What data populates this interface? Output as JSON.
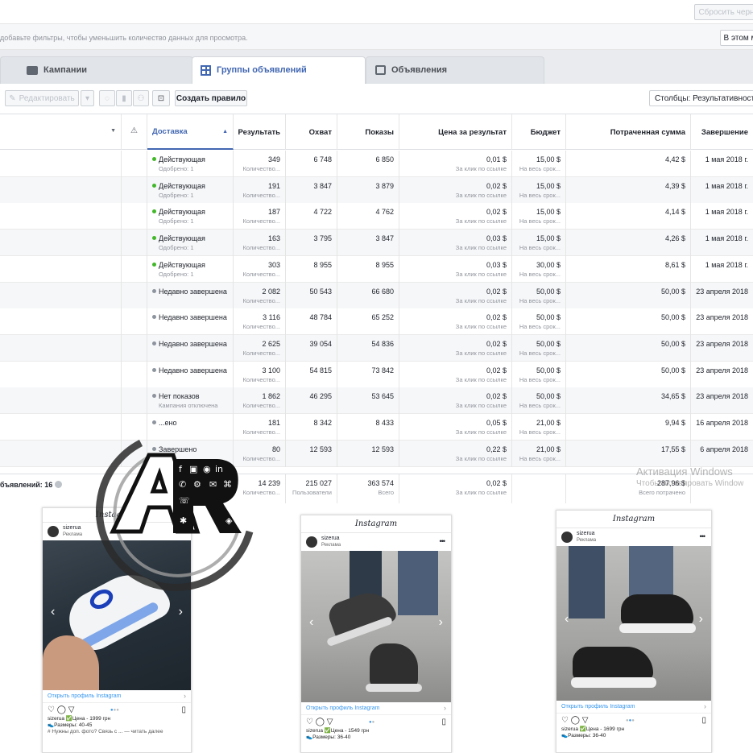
{
  "topbar": {
    "reset_label": "Сбросить черн",
    "filter_hint": "добавьте фильтры, чтобы уменьшить количество данных для просмотра.",
    "period_label": "В этом м"
  },
  "tabs": [
    {
      "label": "Кампании",
      "icon": "briefcase-icon"
    },
    {
      "label": "Группы объявлений",
      "icon": "grid-icon"
    },
    {
      "label": "Объявления",
      "icon": "monitor-icon"
    }
  ],
  "toolbar": {
    "edit_label": "Редактировать",
    "create_rule_label": "Создать правило",
    "columns_label": "Столбцы: Результативность"
  },
  "columns": [
    "Доставка",
    "Результать",
    "Охват",
    "Показы",
    "Цена за результат",
    "Бюджет",
    "Потраченная сумма",
    "Завершение"
  ],
  "rows": [
    {
      "status": "Действующая",
      "sub": "Одобрено: 1",
      "state": "active",
      "result": "349",
      "result_sub": "Количество...",
      "reach": "6 748",
      "impr": "6 850",
      "cpr": "0,01 $",
      "cpr_sub": "За клик по ссылке",
      "budget": "15,00 $",
      "budget_sub": "На весь срок...",
      "spent": "4,42 $",
      "end": "1 мая 2018 г."
    },
    {
      "status": "Действующая",
      "sub": "Одобрено: 1",
      "state": "active",
      "result": "191",
      "result_sub": "Количество...",
      "reach": "3 847",
      "impr": "3 879",
      "cpr": "0,02 $",
      "cpr_sub": "За клик по ссылке",
      "budget": "15,00 $",
      "budget_sub": "На весь срок...",
      "spent": "4,39 $",
      "end": "1 мая 2018 г."
    },
    {
      "status": "Действующая",
      "sub": "Одобрено: 1",
      "state": "active",
      "result": "187",
      "result_sub": "Количество...",
      "reach": "4 722",
      "impr": "4 762",
      "cpr": "0,02 $",
      "cpr_sub": "За клик по ссылке",
      "budget": "15,00 $",
      "budget_sub": "На весь срок...",
      "spent": "4,14 $",
      "end": "1 мая 2018 г."
    },
    {
      "status": "Действующая",
      "sub": "Одобрено: 1",
      "state": "active",
      "result": "163",
      "result_sub": "Количество...",
      "reach": "3 795",
      "impr": "3 847",
      "cpr": "0,03 $",
      "cpr_sub": "За клик по ссылке",
      "budget": "15,00 $",
      "budget_sub": "На весь срок...",
      "spent": "4,26 $",
      "end": "1 мая 2018 г."
    },
    {
      "status": "Действующая",
      "sub": "Одобрено: 1",
      "state": "active",
      "result": "303",
      "result_sub": "Количество...",
      "reach": "8 955",
      "impr": "8 955",
      "cpr": "0,03 $",
      "cpr_sub": "За клик по ссылке",
      "budget": "30,00 $",
      "budget_sub": "На весь срок...",
      "spent": "8,61 $",
      "end": "1 мая 2018 г."
    },
    {
      "status": "Недавно завершена",
      "sub": "",
      "state": "ended",
      "result": "2 082",
      "result_sub": "Количество...",
      "reach": "50 543",
      "impr": "66 680",
      "cpr": "0,02 $",
      "cpr_sub": "За клик по ссылке",
      "budget": "50,00 $",
      "budget_sub": "На весь срок...",
      "spent": "50,00 $",
      "end": "23 апреля 2018"
    },
    {
      "status": "Недавно завершена",
      "sub": "",
      "state": "ended",
      "result": "3 116",
      "result_sub": "Количество...",
      "reach": "48 784",
      "impr": "65 252",
      "cpr": "0,02 $",
      "cpr_sub": "За клик по ссылке",
      "budget": "50,00 $",
      "budget_sub": "На весь срок...",
      "spent": "50,00 $",
      "end": "23 апреля 2018"
    },
    {
      "status": "Недавно завершена",
      "sub": "",
      "state": "ended",
      "result": "2 625",
      "result_sub": "Количество...",
      "reach": "39 054",
      "impr": "54 836",
      "cpr": "0,02 $",
      "cpr_sub": "За клик по ссылке",
      "budget": "50,00 $",
      "budget_sub": "На весь срок...",
      "spent": "50,00 $",
      "end": "23 апреля 2018"
    },
    {
      "status": "Недавно завершена",
      "sub": "",
      "state": "ended",
      "result": "3 100",
      "result_sub": "Количество...",
      "reach": "54 815",
      "impr": "73 842",
      "cpr": "0,02 $",
      "cpr_sub": "За клик по ссылке",
      "budget": "50,00 $",
      "budget_sub": "На весь срок...",
      "spent": "50,00 $",
      "end": "23 апреля 2018"
    },
    {
      "status": "Нет показов",
      "sub": "Кампания отключена",
      "state": "ended",
      "result": "1 862",
      "result_sub": "Количество...",
      "reach": "46 295",
      "impr": "53 645",
      "cpr": "0,02 $",
      "cpr_sub": "За клик по ссылке",
      "budget": "50,00 $",
      "budget_sub": "На весь срок...",
      "spent": "34,65 $",
      "end": "23 апреля 2018"
    },
    {
      "status": "...ено",
      "sub": "",
      "state": "ended",
      "result": "181",
      "result_sub": "Количество...",
      "reach": "8 342",
      "impr": "8 433",
      "cpr": "0,05 $",
      "cpr_sub": "За клик по ссылке",
      "budget": "21,00 $",
      "budget_sub": "На весь срок...",
      "spent": "9,94 $",
      "end": "16 апреля 2018"
    },
    {
      "status": "Завершено",
      "sub": "",
      "state": "ended",
      "result": "80",
      "result_sub": "Количество...",
      "reach": "12 593",
      "impr": "12 593",
      "cpr": "0,22 $",
      "cpr_sub": "За клик по ссылке",
      "budget": "21,00 $",
      "budget_sub": "На весь срок...",
      "spent": "17,55 $",
      "end": "6 апреля 2018"
    }
  ],
  "totals": {
    "label": "бъявлений: 16",
    "result": "14 239",
    "result_sub": "Количество...",
    "reach": "215 027",
    "reach_sub": "Пользователи",
    "impr": "363 574",
    "impr_sub": "Всего",
    "cpr": "0,02 $",
    "cpr_sub": "За клик по ссылке",
    "spent": "287,96 $",
    "spent_sub": "Всего потрачено"
  },
  "watermark": {
    "line1": "Активация Windows",
    "line2": "Чтобы активировать Window"
  },
  "logo_text": "AR",
  "instagram_cards": [
    {
      "brand": "Instagram",
      "account": "sizerua",
      "sponsored": "Реклама",
      "cta": "Открыть профиль Instagram",
      "caption1": "sizerua ✅Цена - 1999 грн",
      "caption2": "👟Размеры: 40-45",
      "caption3": "# Нужны доп. фото? Связь с ... — читать далее"
    },
    {
      "brand": "Instagram",
      "account": "sizerua",
      "sponsored": "Реклама",
      "cta": "Открыть профиль Instagram",
      "caption1": "sizerua ✅Цена - 1549 грн",
      "caption2": "👟Размеры: 36-40",
      "caption3": ""
    },
    {
      "brand": "Instagram",
      "account": "sizerua",
      "sponsored": "Реклама",
      "cta": "Открыть профиль Instagram",
      "caption1": "sizerua ✅Цена - 1699 грн",
      "caption2": "👟Размеры: 36-40",
      "caption3": ""
    }
  ],
  "colors": {
    "link": "#4267b2",
    "active": "#42b72a",
    "ended": "#8d949e",
    "ig_link": "#3897f0"
  }
}
